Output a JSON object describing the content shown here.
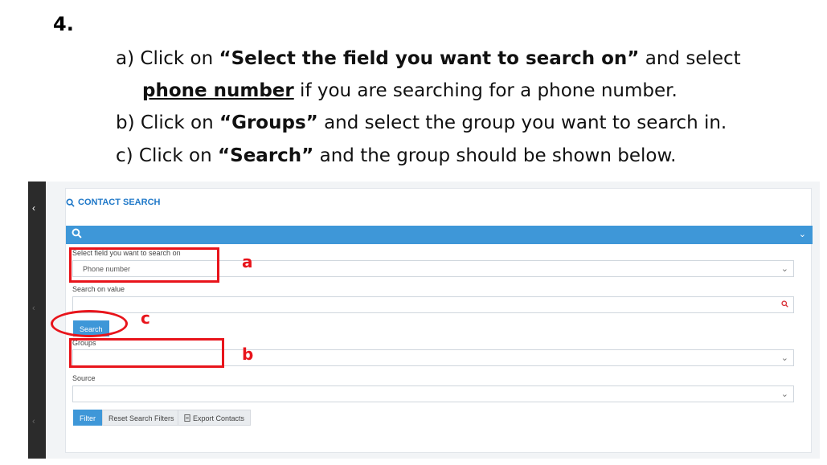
{
  "slide": {
    "step_number": "4.",
    "line_a_prefix": "a) Click on ",
    "line_a_bold": "“Select the field you want to search on”",
    "line_a_suffix": " and select",
    "line_a2_underlined": "phone number",
    "line_a2_suffix": " if you are searching for a phone number.",
    "line_b_prefix": "b) Click on ",
    "line_b_bold": "“Groups”",
    "line_b_suffix": " and select the group you want to search in.",
    "line_c_prefix": "c) Click on ",
    "line_c_bold": "“Search”",
    "line_c_suffix": " and the group should be shown below."
  },
  "app": {
    "panel_title": "CONTACT SEARCH",
    "field_select_label": "Select field you want to search on",
    "field_select_value": "Phone number",
    "search_value_label": "Search on value",
    "search_value_input": "",
    "search_button": "Search",
    "groups_label": "Groups",
    "groups_value": "",
    "source_label": "Source",
    "source_value": "",
    "filter_button": "Filter",
    "reset_button": "Reset Search Filters",
    "export_button": "Export Contacts"
  },
  "annotations": {
    "label_a": "a",
    "label_b": "b",
    "label_c": "c",
    "color": "#e8141b"
  },
  "colors": {
    "accent": "#3e97d8",
    "title_blue": "#1f78c8",
    "sidebar": "#2b2b2b"
  }
}
